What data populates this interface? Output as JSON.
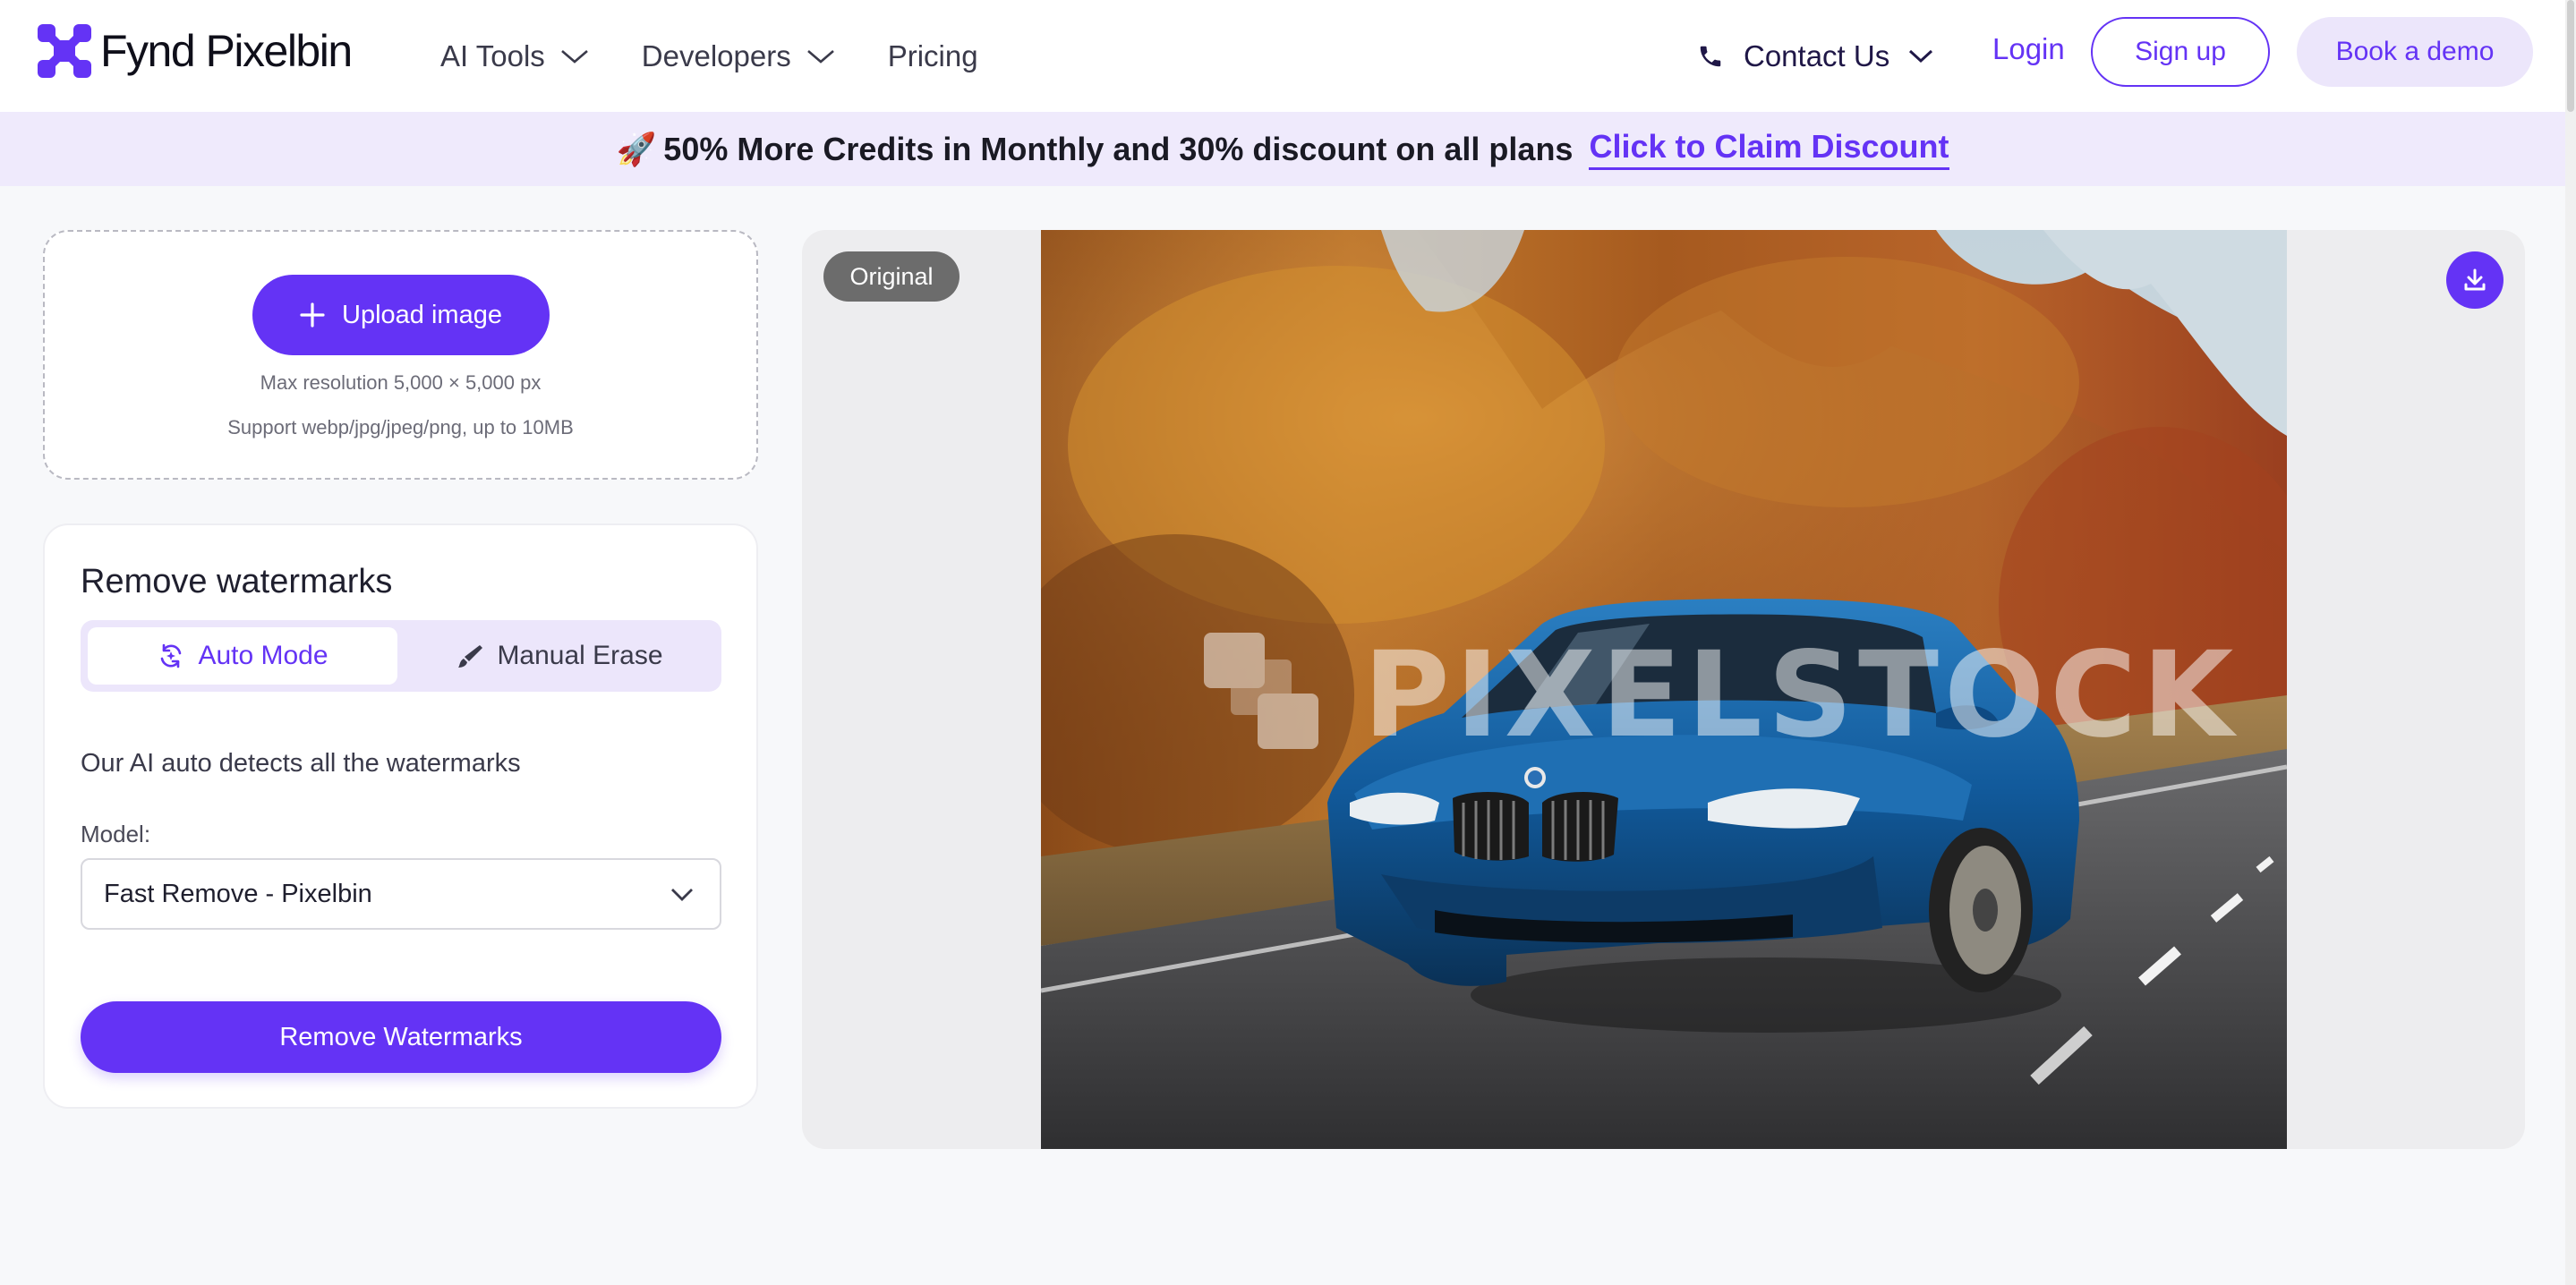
{
  "brand": {
    "name": "Fynd Pixelbin",
    "accent": "#6433f5",
    "accent_soft": "#ece6fb"
  },
  "nav": {
    "items": [
      {
        "label": "AI Tools",
        "has_dropdown": true
      },
      {
        "label": "Developers",
        "has_dropdown": true
      },
      {
        "label": "Pricing",
        "has_dropdown": false
      }
    ],
    "contact": "Contact Us",
    "login": "Login",
    "signup": "Sign up",
    "demo": "Book a demo"
  },
  "banner": {
    "icon": "rocket-icon",
    "text": "50% More Credits in Monthly and 30% discount on all plans",
    "cta": "Click to Claim Discount"
  },
  "upload": {
    "button": "Upload image",
    "note_resolution": "Max resolution 5,000 × 5,000 px",
    "note_formats": "Support webp/jpg/jpeg/png, up to 10MB"
  },
  "settings": {
    "title": "Remove watermarks",
    "modes": [
      {
        "label": "Auto Mode",
        "icon": "auto-mode-icon",
        "active": true
      },
      {
        "label": "Manual Erase",
        "icon": "brush-icon",
        "active": false
      }
    ],
    "description": "Our AI auto detects all the watermarks",
    "model_label": "Model:",
    "model_value": "Fast Remove - Pixelbin",
    "submit": "Remove Watermarks"
  },
  "preview": {
    "badge": "Original",
    "watermark_text": "PIXELSTOCK",
    "download_icon": "download-icon"
  }
}
